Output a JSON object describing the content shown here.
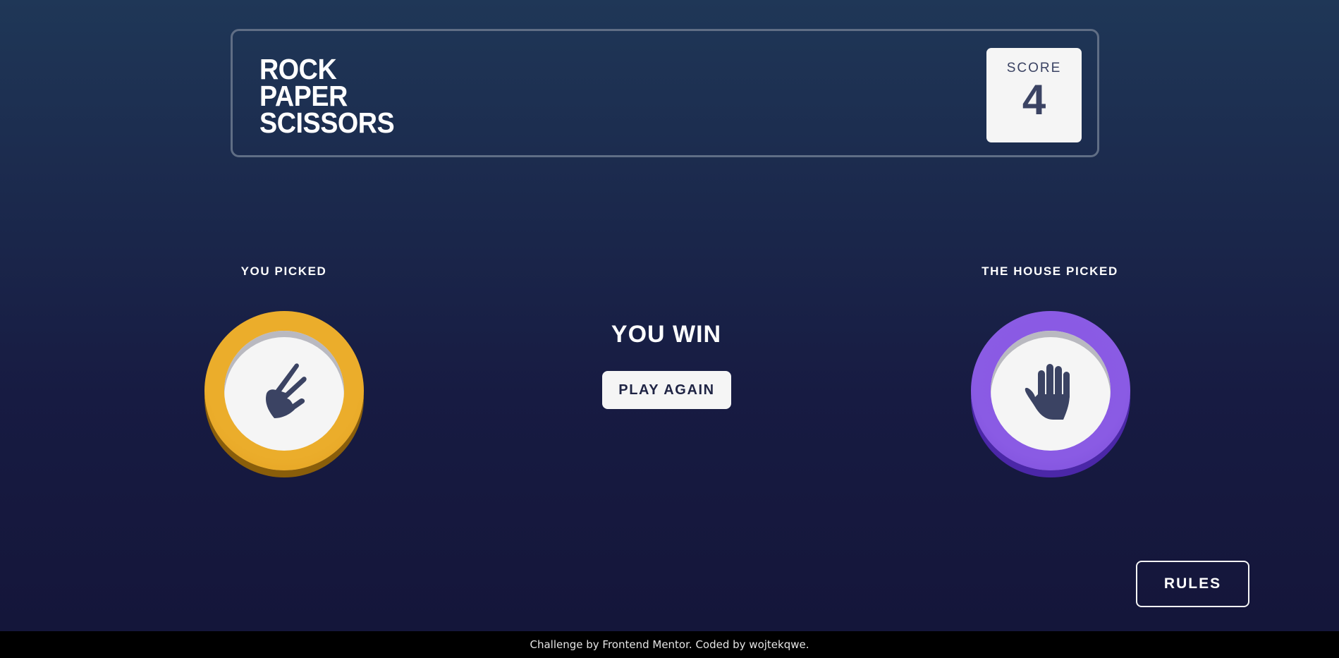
{
  "header": {
    "logo_lines": [
      "ROCK",
      "PAPER",
      "SCISSORS"
    ],
    "score_label": "SCORE",
    "score_value": "4"
  },
  "game": {
    "you_picked_label": "YOU PICKED",
    "house_picked_label": "THE HOUSE PICKED",
    "player_choice": "scissors",
    "house_choice": "paper",
    "result_text": "YOU WIN",
    "play_again_label": "PLAY AGAIN"
  },
  "rules_label": "RULES",
  "footer": {
    "text": "Challenge by Frontend Mentor. Coded by wojtekqwe."
  },
  "colors": {
    "scissors": "#ebad2b",
    "paper": "#8a5be4",
    "background_top": "#1f3757",
    "background_bottom": "#141539",
    "icon": "#3b4363"
  }
}
